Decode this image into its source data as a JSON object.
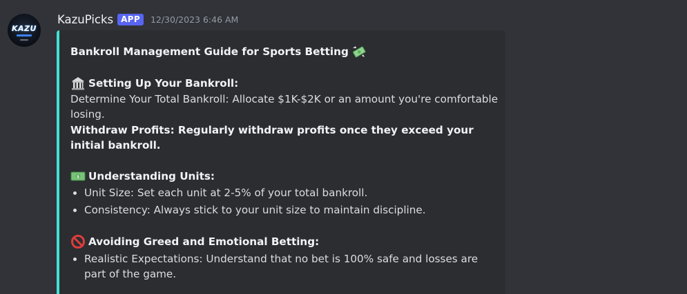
{
  "message": {
    "username": "KazuPicks",
    "badge": "APP",
    "timestamp": "12/30/2023 6:46 AM",
    "avatar_logo_text": "KAZU",
    "embed": {
      "accent_color": "#43e0d6",
      "title": "Bankroll Management Guide for Sports Betting",
      "title_icon": "money-with-wings-icon",
      "sections": [
        {
          "icon": "bank-icon",
          "heading": "Setting Up Your Bankroll:",
          "lines": [
            "Determine Your Total Bankroll: Allocate $1K-$2K or an amount you're comfortable losing."
          ],
          "bold_lines": [
            "Withdraw Profits: Regularly withdraw profits once they exceed your initial bankroll."
          ]
        },
        {
          "icon": "dollar-banknote-icon",
          "heading": "Understanding Units:",
          "bullets": [
            "Unit Size: Set each unit at 2-5% of your total bankroll.",
            "Consistency: Always stick to your unit size to maintain discipline."
          ]
        },
        {
          "icon": "prohibited-icon",
          "heading": "Avoiding Greed and Emotional Betting:",
          "bullets": [
            "Realistic Expectations: Understand that no bet is 100% safe and losses are part of the game."
          ]
        }
      ]
    }
  },
  "colors": {
    "background": "#313338",
    "embed_background": "#2b2d31",
    "badge": "#5865f2",
    "text": "#dbdee1",
    "timestamp": "#949ba4"
  }
}
